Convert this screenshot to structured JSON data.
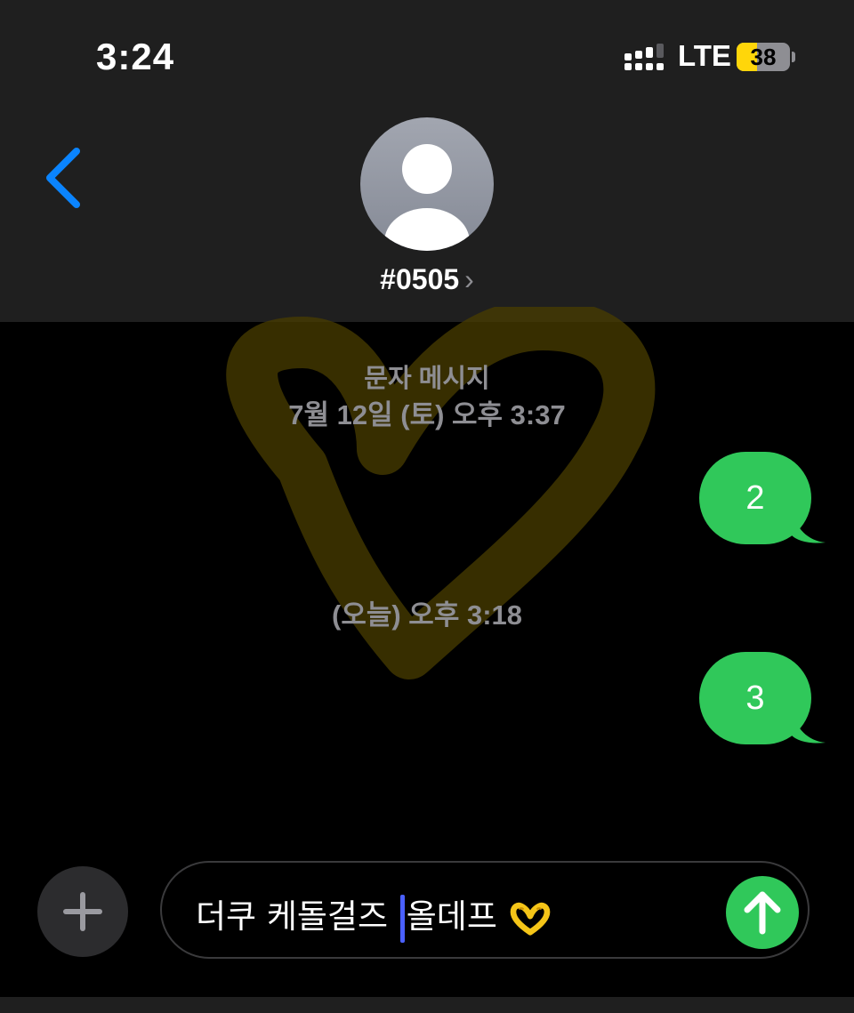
{
  "status_bar": {
    "time": "3:24",
    "network": "LTE",
    "battery_level": "38",
    "battery_fraction": 0.38
  },
  "header": {
    "back_icon": "chevron-left-icon",
    "avatar_icon": "person-silhouette-icon",
    "contact_name": "#0505",
    "contact_chevron": "›"
  },
  "conversation": {
    "service_label": "문자 메시지",
    "first_timestamp": "7월 12일 (토) 오후 3:37",
    "second_timestamp": "(오늘) 오후 3:18",
    "messages": [
      {
        "text": "2",
        "direction": "outgoing"
      },
      {
        "text": "3",
        "direction": "outgoing"
      }
    ]
  },
  "composer": {
    "plus_icon": "plus-icon",
    "text_before_cursor": "더쿠 케돌걸즈 ",
    "text_after_cursor": "올데프",
    "emoji": "🫶",
    "send_icon": "arrow-up-icon"
  },
  "colors": {
    "bubble": "#30c85a",
    "header_bg": "#1f1f1f",
    "accent_blue": "#0a84ff",
    "caret": "#4a60ff",
    "wallpaper_yellow": "#ffd60a"
  }
}
